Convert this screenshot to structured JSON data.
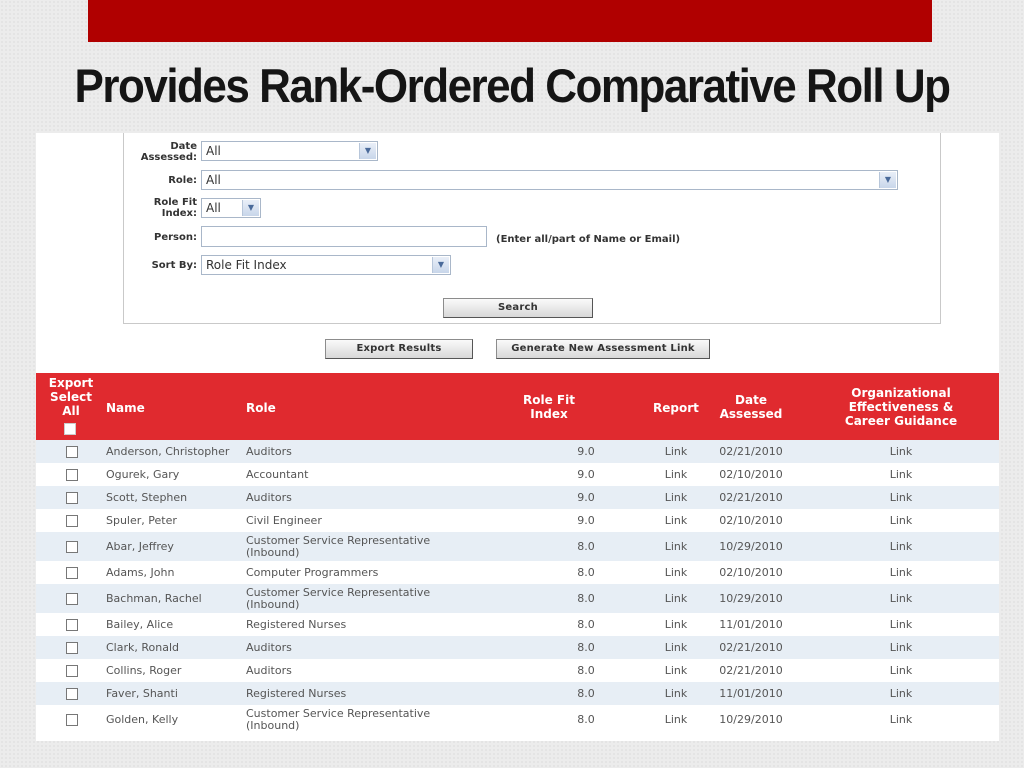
{
  "slide": {
    "title": "Provides Rank-Ordered Comparative Roll Up"
  },
  "filters": {
    "date_label": "Date Assessed:",
    "date_value": "All",
    "role_label": "Role:",
    "role_value": "All",
    "fit_label": "Role Fit Index:",
    "fit_value": "All",
    "person_label": "Person:",
    "person_value": "",
    "person_hint": "(Enter all/part of Name or Email)",
    "sort_label": "Sort By:",
    "sort_value": "Role Fit Index",
    "search_button": "Search"
  },
  "actions": {
    "export_button": "Export Results",
    "generate_button": "Generate New Assessment Link"
  },
  "table": {
    "headers": {
      "export": "Export Select All",
      "name": "Name",
      "role": "Role",
      "fit": "Role Fit Index",
      "report": "Report",
      "date": "Date Assessed",
      "org": "Organizational Effectiveness & Career Guidance"
    },
    "rows": [
      {
        "name": "Anderson, Christopher",
        "role": "Auditors",
        "fit": "9.0",
        "report": "Link",
        "date": "02/21/2010",
        "org": "Link"
      },
      {
        "name": "Ogurek, Gary",
        "role": "Accountant",
        "fit": "9.0",
        "report": "Link",
        "date": "02/10/2010",
        "org": "Link"
      },
      {
        "name": "Scott, Stephen",
        "role": "Auditors",
        "fit": "9.0",
        "report": "Link",
        "date": "02/21/2010",
        "org": "Link"
      },
      {
        "name": "Spuler, Peter",
        "role": "Civil Engineer",
        "fit": "9.0",
        "report": "Link",
        "date": "02/10/2010",
        "org": "Link"
      },
      {
        "name": "Abar, Jeffrey",
        "role": "Customer Service Representative (Inbound)",
        "fit": "8.0",
        "report": "Link",
        "date": "10/29/2010",
        "org": "Link"
      },
      {
        "name": "Adams, John",
        "role": "Computer Programmers",
        "fit": "8.0",
        "report": "Link",
        "date": "02/10/2010",
        "org": "Link"
      },
      {
        "name": "Bachman, Rachel",
        "role": "Customer Service Representative (Inbound)",
        "fit": "8.0",
        "report": "Link",
        "date": "10/29/2010",
        "org": "Link"
      },
      {
        "name": "Bailey, Alice",
        "role": "Registered Nurses",
        "fit": "8.0",
        "report": "Link",
        "date": "11/01/2010",
        "org": "Link"
      },
      {
        "name": "Clark, Ronald",
        "role": "Auditors",
        "fit": "8.0",
        "report": "Link",
        "date": "02/21/2010",
        "org": "Link"
      },
      {
        "name": "Collins, Roger",
        "role": "Auditors",
        "fit": "8.0",
        "report": "Link",
        "date": "02/21/2010",
        "org": "Link"
      },
      {
        "name": "Faver, Shanti",
        "role": "Registered Nurses",
        "fit": "8.0",
        "report": "Link",
        "date": "11/01/2010",
        "org": "Link"
      },
      {
        "name": "Golden, Kelly",
        "role": "Customer Service Representative (Inbound)",
        "fit": "8.0",
        "report": "Link",
        "date": "10/29/2010",
        "org": "Link"
      }
    ]
  }
}
